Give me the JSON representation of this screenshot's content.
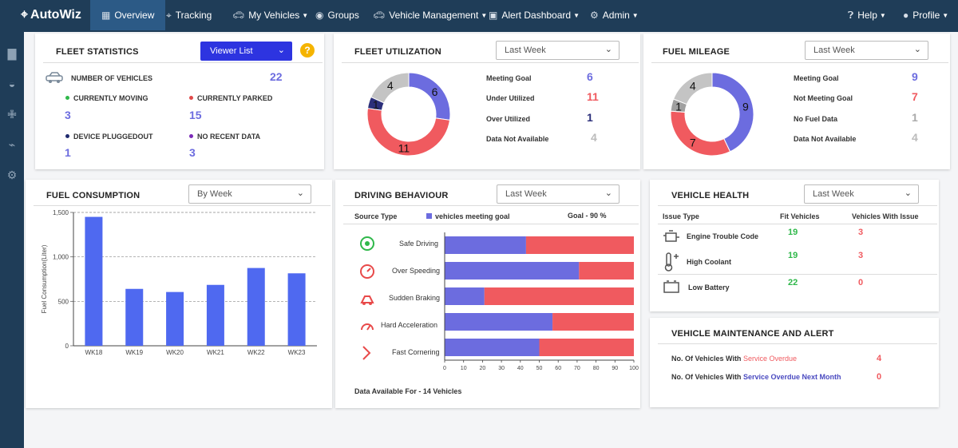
{
  "nav": {
    "logo": "AutoWiz",
    "items": [
      {
        "label": "Overview",
        "icon": "grid-icon"
      },
      {
        "label": "Tracking",
        "icon": "crosshair-icon"
      },
      {
        "label": "My Vehicles",
        "icon": "car-icon"
      },
      {
        "label": "Groups",
        "icon": "groups-icon"
      },
      {
        "label": "Vehicle Management",
        "icon": "car-icon"
      },
      {
        "label": "Alert Dashboard",
        "icon": "alert-icon"
      },
      {
        "label": "Admin",
        "icon": "gear-icon"
      }
    ],
    "help": "Help",
    "profile": "Profile"
  },
  "sidebar": {
    "icons": [
      "bar-chart-icon",
      "car-front-icon",
      "seat-icon",
      "car-crash-icon",
      "gear-icon"
    ]
  },
  "fleet_stats": {
    "title": "FLEET STATISTICS",
    "viewer": "Viewer List",
    "help": "?",
    "num_vehicles_label": "NUMBER OF VEHICLES",
    "num_vehicles": "22",
    "moving_label": "CURRENTLY MOVING",
    "moving": "3",
    "parked_label": "CURRENTLY PARKED",
    "parked": "15",
    "plugged_label": "DEVICE PLUGGEDOUT",
    "plugged": "1",
    "norecent_label": "NO RECENT DATA",
    "norecent": "3",
    "colors": {
      "moving": "#2fb84a",
      "parked": "#e04a4a",
      "plugged": "#1f2a6e",
      "norecent": "#7b2ab8",
      "value": "#6c6cdf"
    }
  },
  "fleet_util": {
    "title": "FLEET UTILIZATION",
    "period": "Last Week",
    "rows": [
      {
        "label": "Meeting Goal",
        "value": "6",
        "color": "#6c6cdf"
      },
      {
        "label": "Under Utilized",
        "value": "11",
        "color": "#f05a5f"
      },
      {
        "label": "Over Utilized",
        "value": "1",
        "color": "#2b2f7a"
      },
      {
        "label": "Data Not Available",
        "value": "4",
        "color": "#bbbbbb"
      }
    ]
  },
  "fuel_mileage": {
    "title": "FUEL MILEAGE",
    "period": "Last Week",
    "rows": [
      {
        "label": "Meeting Goal",
        "value": "9",
        "color": "#6c6cdf"
      },
      {
        "label": "Not Meeting Goal",
        "value": "7",
        "color": "#f05a5f"
      },
      {
        "label": "No Fuel Data",
        "value": "1",
        "color": "#aaaaaa"
      },
      {
        "label": "Data Not Available",
        "value": "4",
        "color": "#bbbbbb"
      }
    ]
  },
  "fuel_consumption": {
    "title": "FUEL CONSUMPTION",
    "period": "By Week"
  },
  "driving": {
    "title": "DRIVING BEHAVIOUR",
    "period": "Last Week",
    "source_label": "Source Type",
    "legend": "vehicles meeting goal",
    "goal": "Goal - 90 %",
    "footer": "Data Available For - 14 Vehicles",
    "items": [
      {
        "label": "Safe Driving",
        "icon": "safe-driving-icon"
      },
      {
        "label": "Over Speeding",
        "icon": "speedometer-icon"
      },
      {
        "label": "Sudden Braking",
        "icon": "braking-icon"
      },
      {
        "label": "Hard Acceleration",
        "icon": "acceleration-icon"
      },
      {
        "label": "Fast Cornering",
        "icon": "cornering-icon"
      }
    ]
  },
  "vehicle_health": {
    "title": "VEHICLE HEALTH",
    "period": "Last Week",
    "col1": "Issue Type",
    "col2": "Fit Vehicles",
    "col3": "Vehicles With Issue",
    "rows": [
      {
        "label": "Engine Trouble Code",
        "fit": "19",
        "issue": "3",
        "icon": "engine-icon"
      },
      {
        "label": "High Coolant",
        "fit": "19",
        "issue": "3",
        "icon": "thermometer-icon"
      },
      {
        "label": "Low Battery",
        "fit": "22",
        "issue": "0",
        "icon": "battery-icon"
      }
    ],
    "colors": {
      "fit": "#2fb84a",
      "issue": "#f05a5f"
    }
  },
  "maintenance": {
    "title": "VEHICLE MAINTENANCE AND ALERT",
    "row1_prefix": "No. Of Vehicles With ",
    "row1_highlight": "Service Overdue",
    "row1_value": "4",
    "row2_prefix": "No. Of Vehicles With ",
    "row2_highlight": "Service Overdue Next Month",
    "row2_value": "0",
    "colors": {
      "highlight1": "#f05a5f",
      "highlight2": "#4a4ac0",
      "value": "#f05a5f"
    }
  },
  "chart_data": [
    {
      "type": "pie",
      "title": "FLEET UTILIZATION",
      "slices": [
        {
          "label": "Meeting Goal",
          "value": 6,
          "color": "#6c6cdf"
        },
        {
          "label": "Under Utilized",
          "value": 11,
          "color": "#f05a5f"
        },
        {
          "label": "Over Utilized",
          "value": 1,
          "color": "#2b2f7a"
        },
        {
          "label": "Data Not Available",
          "value": 4,
          "color": "#c4c4c4"
        }
      ]
    },
    {
      "type": "pie",
      "title": "FUEL MILEAGE",
      "slices": [
        {
          "label": "Meeting Goal",
          "value": 9,
          "color": "#6c6cdf"
        },
        {
          "label": "Not Meeting Goal",
          "value": 7,
          "color": "#f05a5f"
        },
        {
          "label": "No Fuel Data",
          "value": 1,
          "color": "#a0a0a0"
        },
        {
          "label": "Data Not Available",
          "value": 4,
          "color": "#c4c4c4"
        }
      ]
    },
    {
      "type": "bar",
      "title": "FUEL CONSUMPTION",
      "categories": [
        "WK18",
        "WK19",
        "WK20",
        "WK21",
        "WK22",
        "WK23"
      ],
      "values": [
        1450,
        640,
        605,
        685,
        875,
        815
      ],
      "ylabel": "Fuel Consumption(Liter)",
      "ylim": [
        0,
        1500
      ],
      "yticks": [
        0,
        500,
        1000,
        1500
      ],
      "yticklabels": [
        "0",
        "500",
        "1,000",
        "1,500"
      ],
      "grid": true,
      "color": "#4f69f0"
    },
    {
      "type": "bar",
      "title": "DRIVING BEHAVIOUR",
      "orientation": "horizontal",
      "stacked": true,
      "categories": [
        "Safe Driving",
        "Over Speeding",
        "Sudden Braking",
        "Hard Acceleration",
        "Fast Cornering"
      ],
      "series": [
        {
          "name": "vehicles meeting goal",
          "values": [
            43,
            71,
            21,
            57,
            50
          ],
          "color": "#6c6cdf"
        },
        {
          "values": [
            57,
            29,
            79,
            43,
            50
          ],
          "color": "#f05a5f"
        }
      ],
      "xlim": [
        0,
        100
      ],
      "xticks": [
        0,
        10,
        20,
        30,
        40,
        50,
        60,
        70,
        80,
        90,
        100
      ]
    }
  ]
}
